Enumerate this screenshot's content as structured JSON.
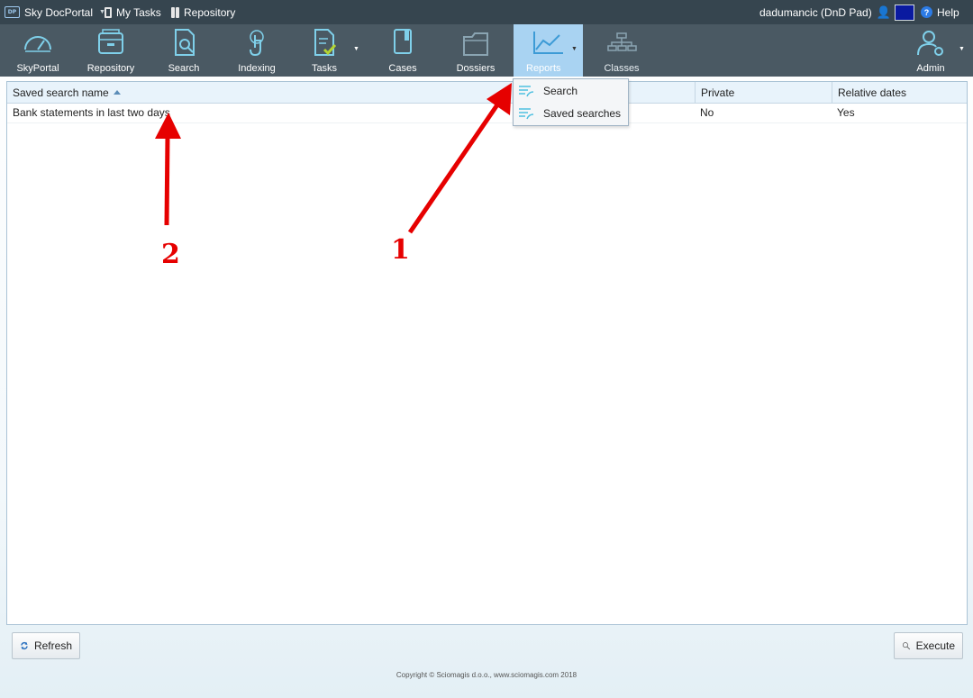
{
  "topbar": {
    "app_name": "Sky DocPortal",
    "logo_text": "DP",
    "my_tasks": "My Tasks",
    "repository": "Repository",
    "user": "dadumancic (DnD Pad)",
    "help": "Help",
    "swatch_color": "#0a1aa0"
  },
  "nav": {
    "items": [
      {
        "label": "SkyPortal",
        "icon": "gauge-icon"
      },
      {
        "label": "Repository",
        "icon": "cabinet-icon"
      },
      {
        "label": "Search",
        "icon": "document-search-icon"
      },
      {
        "label": "Indexing",
        "icon": "touch-icon"
      },
      {
        "label": "Tasks",
        "icon": "task-check-icon"
      },
      {
        "label": "Cases",
        "icon": "book-icon"
      },
      {
        "label": "Dossiers",
        "icon": "folder-icon"
      },
      {
        "label": "Reports",
        "icon": "chart-icon",
        "active": true
      },
      {
        "label": "Classes",
        "icon": "hierarchy-icon"
      },
      {
        "label": "Admin",
        "icon": "user-gear-icon"
      }
    ]
  },
  "reports_menu": {
    "items": [
      {
        "label": "Search"
      },
      {
        "label": "Saved searches"
      }
    ]
  },
  "table": {
    "columns": [
      "Saved search name",
      "Private",
      "Relative dates"
    ],
    "rows": [
      {
        "name": "Bank statements in last two days",
        "private": "No",
        "relative_dates": "Yes"
      }
    ]
  },
  "buttons": {
    "refresh": "Refresh",
    "execute": "Execute"
  },
  "copyright": "Copyright © Sciomagis d.o.o., www.sciomagis.com 2018",
  "annotations": {
    "one": "1",
    "two": "2",
    "color": "#e60000"
  }
}
